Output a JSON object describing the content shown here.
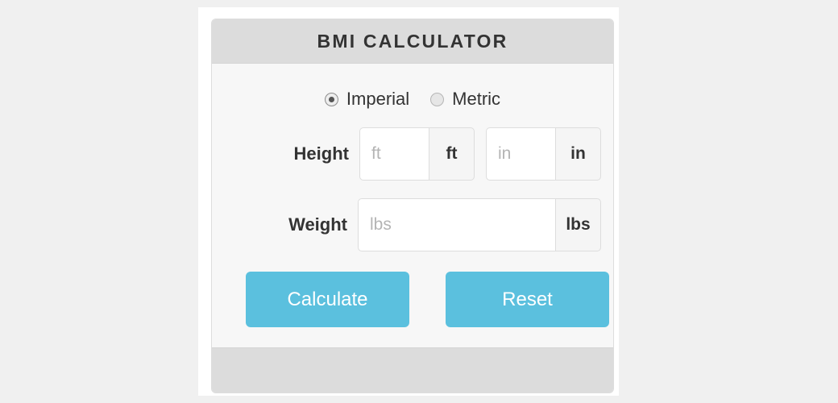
{
  "panel": {
    "title": "BMI CALCULATOR"
  },
  "units": {
    "options": [
      {
        "label": "Imperial",
        "selected": true
      },
      {
        "label": "Metric",
        "selected": false
      }
    ]
  },
  "height": {
    "label": "Height",
    "feet": {
      "value": "",
      "placeholder": "ft",
      "addon": "ft"
    },
    "inches": {
      "value": "",
      "placeholder": "in",
      "addon": "in"
    }
  },
  "weight": {
    "label": "Weight",
    "pounds": {
      "value": "",
      "placeholder": "lbs",
      "addon": "lbs"
    }
  },
  "actions": {
    "calculate_label": "Calculate",
    "reset_label": "Reset"
  },
  "colors": {
    "accent": "#5bc0de",
    "panel_header_bg": "#dcdcdc",
    "panel_body_bg": "#f7f7f7",
    "page_bg": "#f0f0f0",
    "text": "#333333",
    "placeholder": "#b4b4b4"
  }
}
